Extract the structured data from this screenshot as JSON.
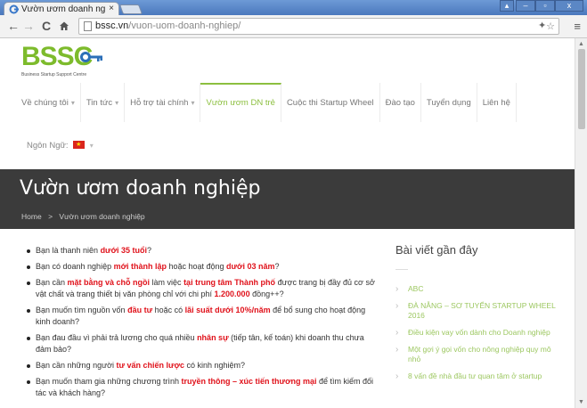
{
  "browser": {
    "tab_title": "Vườn ươm doanh ngh",
    "tab_close": "×",
    "url_host": "bssc.vn",
    "url_path": "/vuon-uom-doanh-nghiep/",
    "window_buttons": [
      "▴",
      "–",
      "▫",
      "x"
    ]
  },
  "site": {
    "logo_text": "BSSC",
    "logo_subtitle": "Business Startup Support Centre",
    "nav": [
      {
        "label": "Về chúng tôi",
        "has_caret": true
      },
      {
        "label": "Tin tức",
        "has_caret": true
      },
      {
        "label": "Hỗ trợ tài chính",
        "has_caret": true
      },
      {
        "label": "Vườn ươm DN trẻ",
        "has_caret": false,
        "active": true
      },
      {
        "label": "Cuộc thi Startup Wheel",
        "has_caret": false
      },
      {
        "label": "Đào tạo",
        "has_caret": false
      },
      {
        "label": "Tuyển dụng",
        "has_caret": false
      },
      {
        "label": "Liên hệ",
        "has_caret": false
      }
    ],
    "language_label": "Ngôn Ngữ:",
    "flag_star": "★",
    "caret": "▾"
  },
  "banner": {
    "title": "Vườn ươm doanh nghiệp",
    "breadcrumb_home": "Home",
    "breadcrumb_sep": ">",
    "breadcrumb_current": "Vườn ươm doanh nghiệp"
  },
  "bullets": [
    [
      {
        "t": "Bạn là thanh niên "
      },
      {
        "t": "dưới 35 tuổi",
        "h": true
      },
      {
        "t": "?"
      }
    ],
    [
      {
        "t": "Bạn có doanh nghiệp "
      },
      {
        "t": "mới thành lập",
        "h": true
      },
      {
        "t": " hoặc hoạt động "
      },
      {
        "t": "dưới 03 năm",
        "h": true
      },
      {
        "t": "?"
      }
    ],
    [
      {
        "t": "Bạn cần "
      },
      {
        "t": "mặt bằng và chỗ ngồi",
        "h": true
      },
      {
        "t": " làm việc "
      },
      {
        "t": "tại trung tâm Thành phố",
        "h": true
      },
      {
        "t": " được trang bị đầy đủ cơ sở vật chất và trang thiết bị văn phòng chỉ với chi phí "
      },
      {
        "t": "1.200.000",
        "h": true
      },
      {
        "t": " đồng++?"
      }
    ],
    [
      {
        "t": "Bạn muốn tìm nguồn vốn "
      },
      {
        "t": "đầu tư",
        "h": true
      },
      {
        "t": " hoặc có "
      },
      {
        "t": "lãi suất dưới 10%/năm",
        "h": true
      },
      {
        "t": " để bổ sung cho hoạt động kinh doanh?"
      }
    ],
    [
      {
        "t": "Bạn đau đầu vì phải trả lương cho quá nhiều "
      },
      {
        "t": "nhân sự",
        "h": true
      },
      {
        "t": " (tiếp tân, kế toán) khi doanh thu chưa đảm bảo?"
      }
    ],
    [
      {
        "t": "Bạn cần những người "
      },
      {
        "t": "tư vấn chiến lược",
        "h": true
      },
      {
        "t": " có kinh nghiệm?"
      }
    ],
    [
      {
        "t": "Bạn muốn tham gia những chương trình "
      },
      {
        "t": "truyền thông – xúc tiến thương mại",
        "h": true
      },
      {
        "t": " để tìm kiếm đối tác và khách hàng?"
      }
    ]
  ],
  "sidebar": {
    "title": "Bài viết gần đây",
    "posts": [
      "ABC",
      "ĐÀ NẴNG – SƠ TUYỂN STARTUP WHEEL 2016",
      "Điều kiện vay vốn dành cho Doanh nghiệp",
      "Một gợi ý gọi vốn cho nông nghiệp quy mô nhỏ",
      "8 vấn đề nhà đầu tư quan tâm ở startup"
    ]
  },
  "colors": {
    "brand_green": "#8cbf3f",
    "highlight_red": "#e0121b",
    "banner_bg": "#3b3b3b"
  }
}
